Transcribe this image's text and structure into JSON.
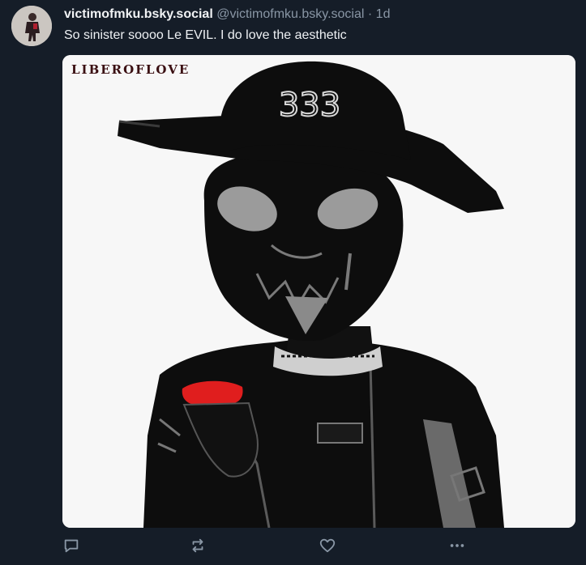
{
  "post": {
    "display_name": "victimofmku.bsky.social",
    "handle": "@victimofmku.bsky.social",
    "separator": "·",
    "time": "1d",
    "text": "So sinister soooo Le EVIL. I do love the aesthetic"
  },
  "media": {
    "watermark": "LIBEROFLOVE",
    "hat_text": "333"
  },
  "actions": {
    "icons": [
      "reply-icon",
      "repost-icon",
      "like-icon",
      "more-icon"
    ]
  },
  "colors": {
    "background": "#151d28",
    "muted": "#8996a5",
    "accent_red": "#e01e1e"
  }
}
